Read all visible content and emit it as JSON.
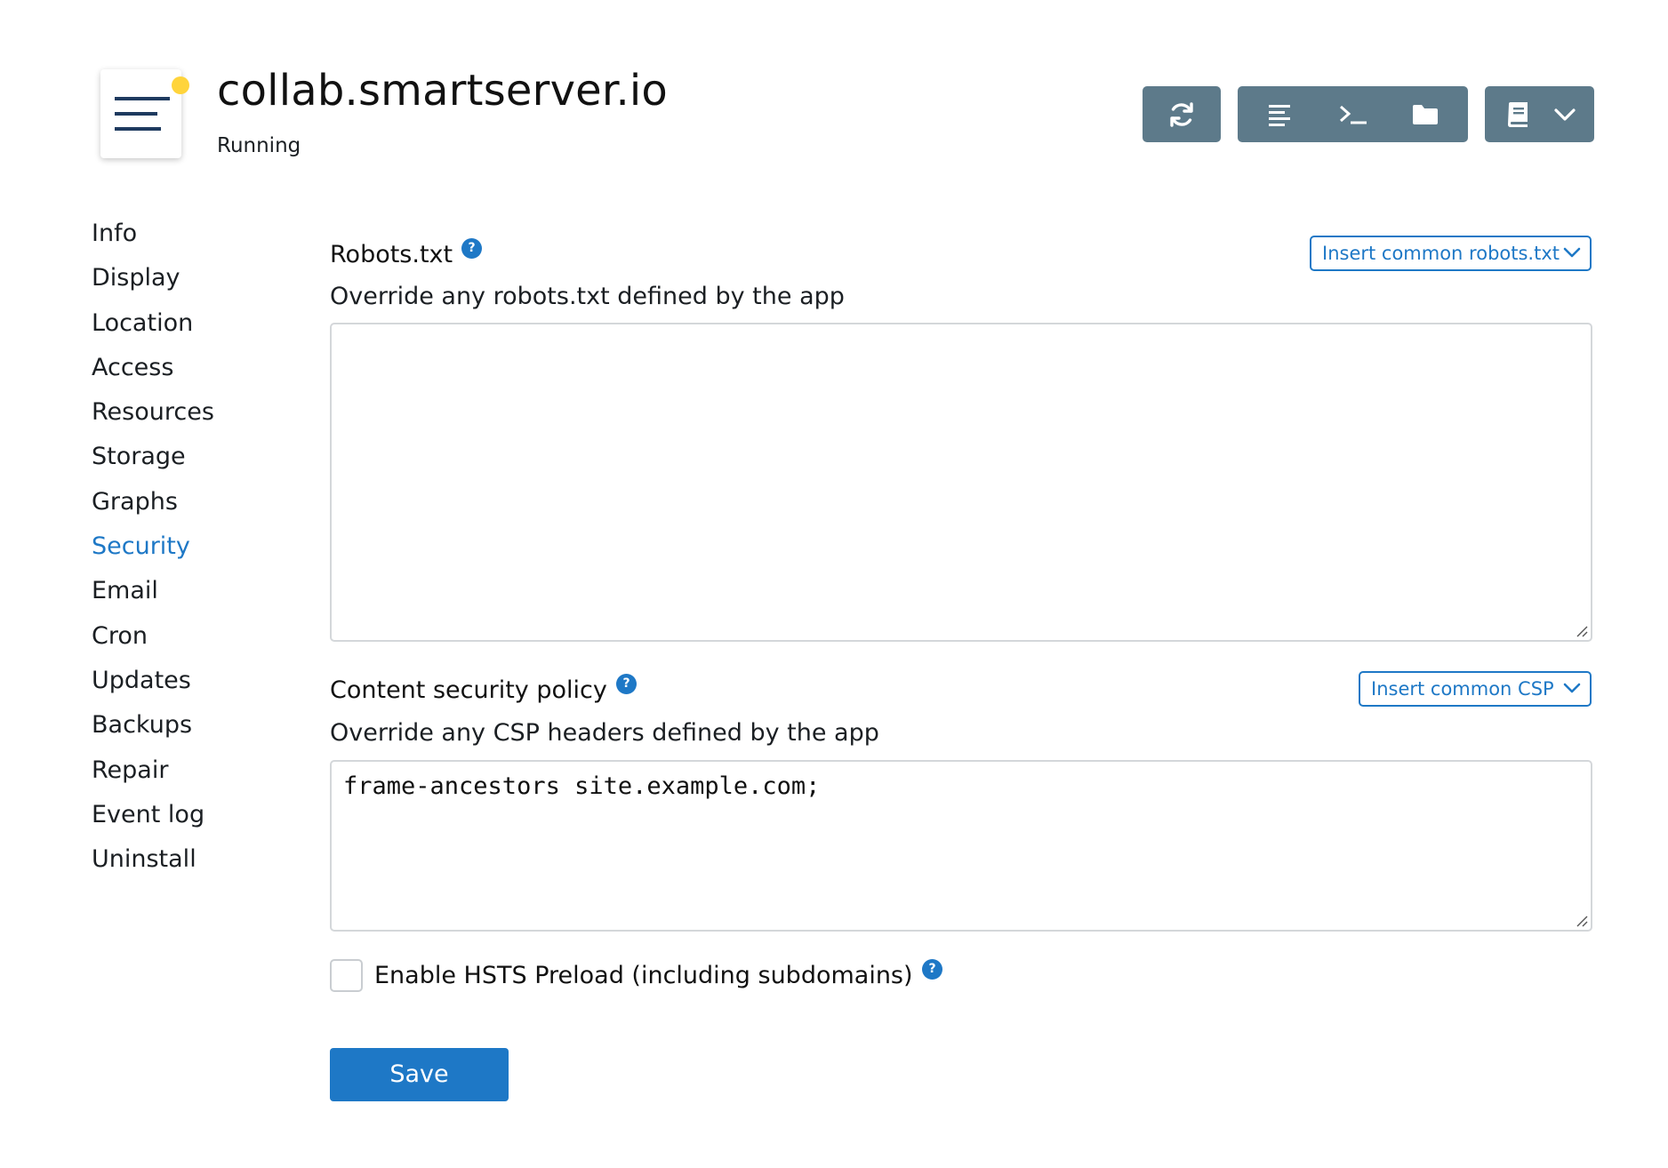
{
  "app": {
    "title": "collab.smartserver.io",
    "status": "Running",
    "icon": "menu-lines-icon",
    "status_dot_color": "#ffd43b"
  },
  "toolbar": {
    "groups": [
      {
        "buttons": [
          {
            "icon": "restart-icon"
          }
        ]
      },
      {
        "buttons": [
          {
            "icon": "logs-icon"
          },
          {
            "icon": "terminal-icon"
          },
          {
            "icon": "folder-icon"
          }
        ]
      },
      {
        "buttons": [
          {
            "icon": "book-icon"
          },
          {
            "icon": "chevron-down-icon"
          }
        ]
      }
    ],
    "color": "#5d7a8a"
  },
  "sidebar": {
    "items": [
      {
        "label": "Info"
      },
      {
        "label": "Display"
      },
      {
        "label": "Location"
      },
      {
        "label": "Access"
      },
      {
        "label": "Resources"
      },
      {
        "label": "Storage"
      },
      {
        "label": "Graphs"
      },
      {
        "label": "Security",
        "active": true
      },
      {
        "label": "Email"
      },
      {
        "label": "Cron"
      },
      {
        "label": "Updates"
      },
      {
        "label": "Backups"
      },
      {
        "label": "Repair"
      },
      {
        "label": "Event log"
      },
      {
        "label": "Uninstall"
      }
    ],
    "active_color": "#1e78c6"
  },
  "security": {
    "robots": {
      "title": "Robots.txt",
      "help": "?",
      "description": "Override any robots.txt defined by the app",
      "insert_label": "Insert common robots.txt",
      "value": ""
    },
    "csp": {
      "title": "Content security policy",
      "help": "?",
      "description": "Override any CSP headers defined by the app",
      "insert_label": "Insert common CSP",
      "value": "frame-ancestors site.example.com;"
    },
    "hsts": {
      "label": "Enable HSTS Preload (including subdomains)",
      "help": "?",
      "checked": false
    },
    "save_label": "Save"
  }
}
